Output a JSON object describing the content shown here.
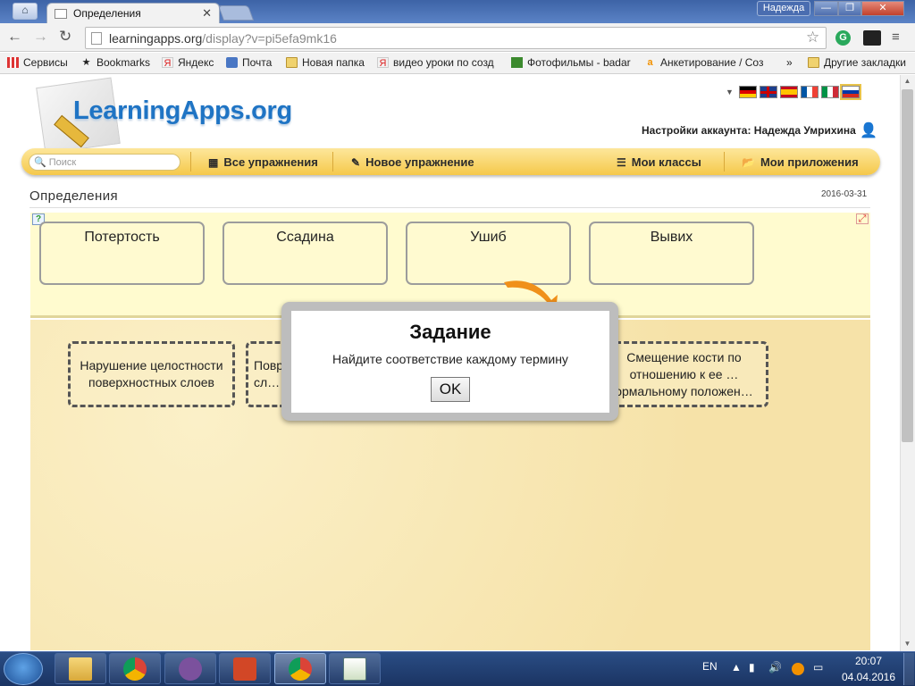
{
  "browser": {
    "tab_title": "Определения",
    "tab_close": "✕",
    "user_button": "Надежда",
    "window_controls": {
      "min": "—",
      "max": "❐",
      "close": "✕"
    },
    "nav": {
      "back": "←",
      "forward": "→",
      "reload": "↻"
    },
    "url_host": "learningapps.org",
    "url_path": "/display?v=pi5efa9mk16",
    "bookmarks": [
      {
        "label": "Сервисы",
        "icon": "apps-grid-icon"
      },
      {
        "label": "Bookmarks",
        "icon": "star-icon"
      },
      {
        "label": "Яндекс",
        "icon": "yandex-icon"
      },
      {
        "label": "Почта",
        "icon": "mail-icon"
      },
      {
        "label": "Новая папка",
        "icon": "folder-icon"
      },
      {
        "label": "видео уроки по созд",
        "icon": "yandex-icon"
      },
      {
        "label": "Фотофильмы - badar",
        "icon": "photo-icon"
      },
      {
        "label": "Анкетирование / Соз",
        "icon": "a-icon"
      }
    ],
    "bookmarks_more": "»",
    "other_bookmarks": "Другие закладки"
  },
  "site": {
    "logo": "LearningApps.org",
    "languages": [
      "de",
      "en",
      "es",
      "fr",
      "it",
      "ru"
    ],
    "account": "Настройки аккаунта: Надежда Умрихина",
    "search_placeholder": "Поиск",
    "menu": {
      "all": "Все упражнения",
      "new": "Новое упражнение",
      "classes": "Мои классы",
      "apps": "Мои приложения"
    },
    "page_title": "Определения",
    "date": "2016-03-31"
  },
  "exercise": {
    "terms": [
      "Потертость",
      "Ссадина",
      "Ушиб",
      "Вывих"
    ],
    "definitions": [
      "Нарушение целостности поверхностных слоев",
      "Повр… сл…",
      "Смещение кости по отношению к ее …ормальному положен…"
    ]
  },
  "dialog": {
    "title": "Задание",
    "message": "Найдите соответствие каждому термину",
    "ok": "OK"
  },
  "taskbar": {
    "lang": "EN",
    "time": "20:07",
    "date": "04.04.2016"
  },
  "colors": {
    "brand_blue": "#1f74c4",
    "toolbar_yellow": "#f5c84a",
    "card_bg": "#fffad0",
    "arrow_orange": "#f0901a"
  }
}
